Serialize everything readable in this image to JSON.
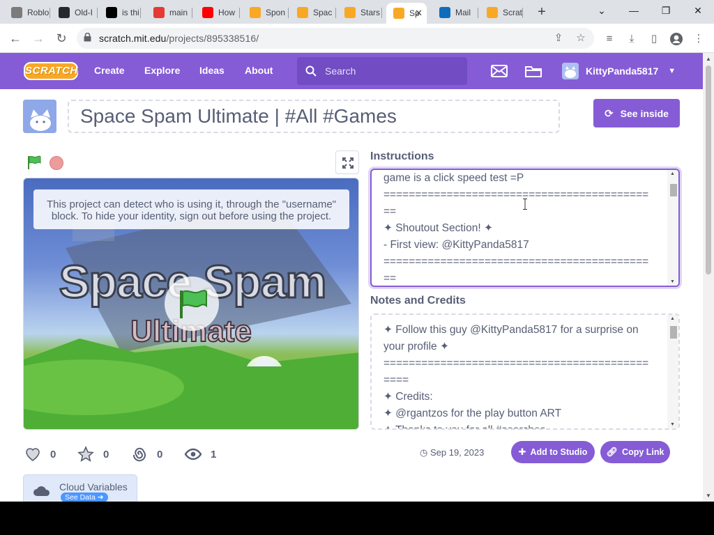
{
  "browser": {
    "tabs": [
      {
        "label": "Roblo",
        "icon": "roblox-icon",
        "color": "#7b7b7b"
      },
      {
        "label": "Old-I",
        "icon": "github-icon",
        "color": "#24292f"
      },
      {
        "label": "is thi",
        "icon": "tiktok-icon",
        "color": "#010101"
      },
      {
        "label": "main",
        "icon": "youtube-shorts-icon",
        "color": "#e53935"
      },
      {
        "label": "How",
        "icon": "youtube-icon",
        "color": "#ff0000"
      },
      {
        "label": "Spon",
        "icon": "scratch-icon",
        "color": "#f9a825"
      },
      {
        "label": "Spac",
        "icon": "scratch-icon",
        "color": "#f9a825"
      },
      {
        "label": "Stars",
        "icon": "scratch-icon",
        "color": "#f9a825"
      },
      {
        "label": "Sp",
        "icon": "scratch-icon",
        "color": "#f9a825",
        "active": true
      },
      {
        "label": "Mail",
        "icon": "outlook-icon",
        "color": "#0f6cbd"
      },
      {
        "label": "Scrat",
        "icon": "scratch-icon",
        "color": "#f9a825"
      }
    ],
    "url_host": "scratch.mit.edu",
    "url_path": "/projects/895338516/"
  },
  "menubar": {
    "logo": "SCRATCH",
    "nav": [
      "Create",
      "Explore",
      "Ideas",
      "About"
    ],
    "search_placeholder": "Search",
    "username": "KittyPanda5817"
  },
  "project": {
    "title": "Space Spam Ultimate | #All #Games",
    "see_inside": "See inside",
    "stage_notice": "This project can detect who is using it, through the \"username\" block. To hide your identity, sign out before using the project.",
    "stage_title": "Space Spam",
    "stage_subtitle": "Ultimate"
  },
  "instructions": {
    "label": "Instructions",
    "lines": [
      "game is a click speed test =P",
      "==========================================",
      "==",
      "✦ Shoutout Section! ✦",
      "- First view: @KittyPanda5817",
      "==========================================",
      "=="
    ]
  },
  "notes": {
    "label": "Notes and Credits",
    "lines": [
      "✦ Follow this guy @KittyPanda5817 for a surprise on",
      "your profile ✦",
      "==========================================",
      "====",
      "✦ Credits:",
      "✦ @rgantzos for the play button ART",
      "✦ Thanks to you for all #searches"
    ]
  },
  "stats": {
    "loves": "0",
    "favorites": "0",
    "remixes": "0",
    "views": "1"
  },
  "date": "Sep 19, 2023",
  "buttons": {
    "add_to_studio": "Add to Studio",
    "copy_link": "Copy Link"
  },
  "cloud": {
    "title": "Cloud Variables",
    "see_data": "See Data"
  },
  "colors": {
    "scratch_purple": "#855cd6",
    "scratch_blue": "#4c97ff",
    "scratch_orange": "#f9a825"
  }
}
